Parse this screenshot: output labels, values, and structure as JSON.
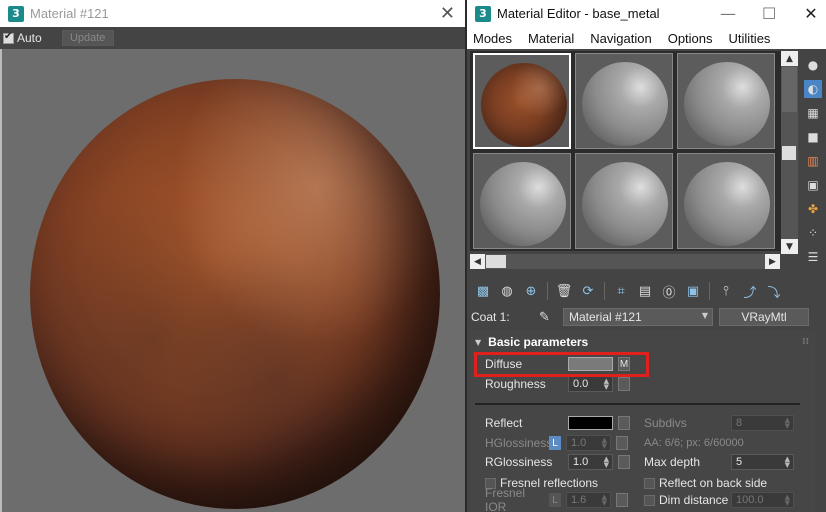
{
  "preview_window": {
    "title": "Material #121",
    "auto_label": "Auto",
    "auto_checked": true,
    "update_label": "Update"
  },
  "editor": {
    "title": "Material Editor - base_metal",
    "menu": [
      "Modes",
      "Material",
      "Navigation",
      "Options",
      "Utilities"
    ],
    "coat_label": "Coat 1:",
    "material_name": "Material #121",
    "material_type": "VRayMtl",
    "rollout_title": "Basic parameters",
    "params": {
      "diffuse_label": "Diffuse",
      "diffuse_color": "#7a7a7a",
      "diffuse_map": "M",
      "roughness_label": "Roughness",
      "roughness_value": "0.0",
      "reflect_label": "Reflect",
      "reflect_color": "#000000",
      "subdivs_label": "Subdivs",
      "subdivs_value": "8",
      "hglossiness_label": "HGlossiness",
      "hglossiness_lock": "L",
      "hglossiness_value": "1.0",
      "aa_info": "AA: 6/6; px: 6/60000",
      "rglossiness_label": "RGlossiness",
      "rglossiness_value": "1.0",
      "max_depth_label": "Max depth",
      "max_depth_value": "5",
      "fresnel_label": "Fresnel reflections",
      "reflect_back_label": "Reflect on back side",
      "fresnel_ior_label": "Fresnel IOR",
      "fresnel_ior_lock": "L",
      "fresnel_ior_value": "1.6",
      "dim_distance_label": "Dim distance",
      "dim_distance_value": "100.0"
    }
  },
  "colors": {
    "highlight": "#e0201c",
    "lock_blue": "#5b8cc4"
  }
}
